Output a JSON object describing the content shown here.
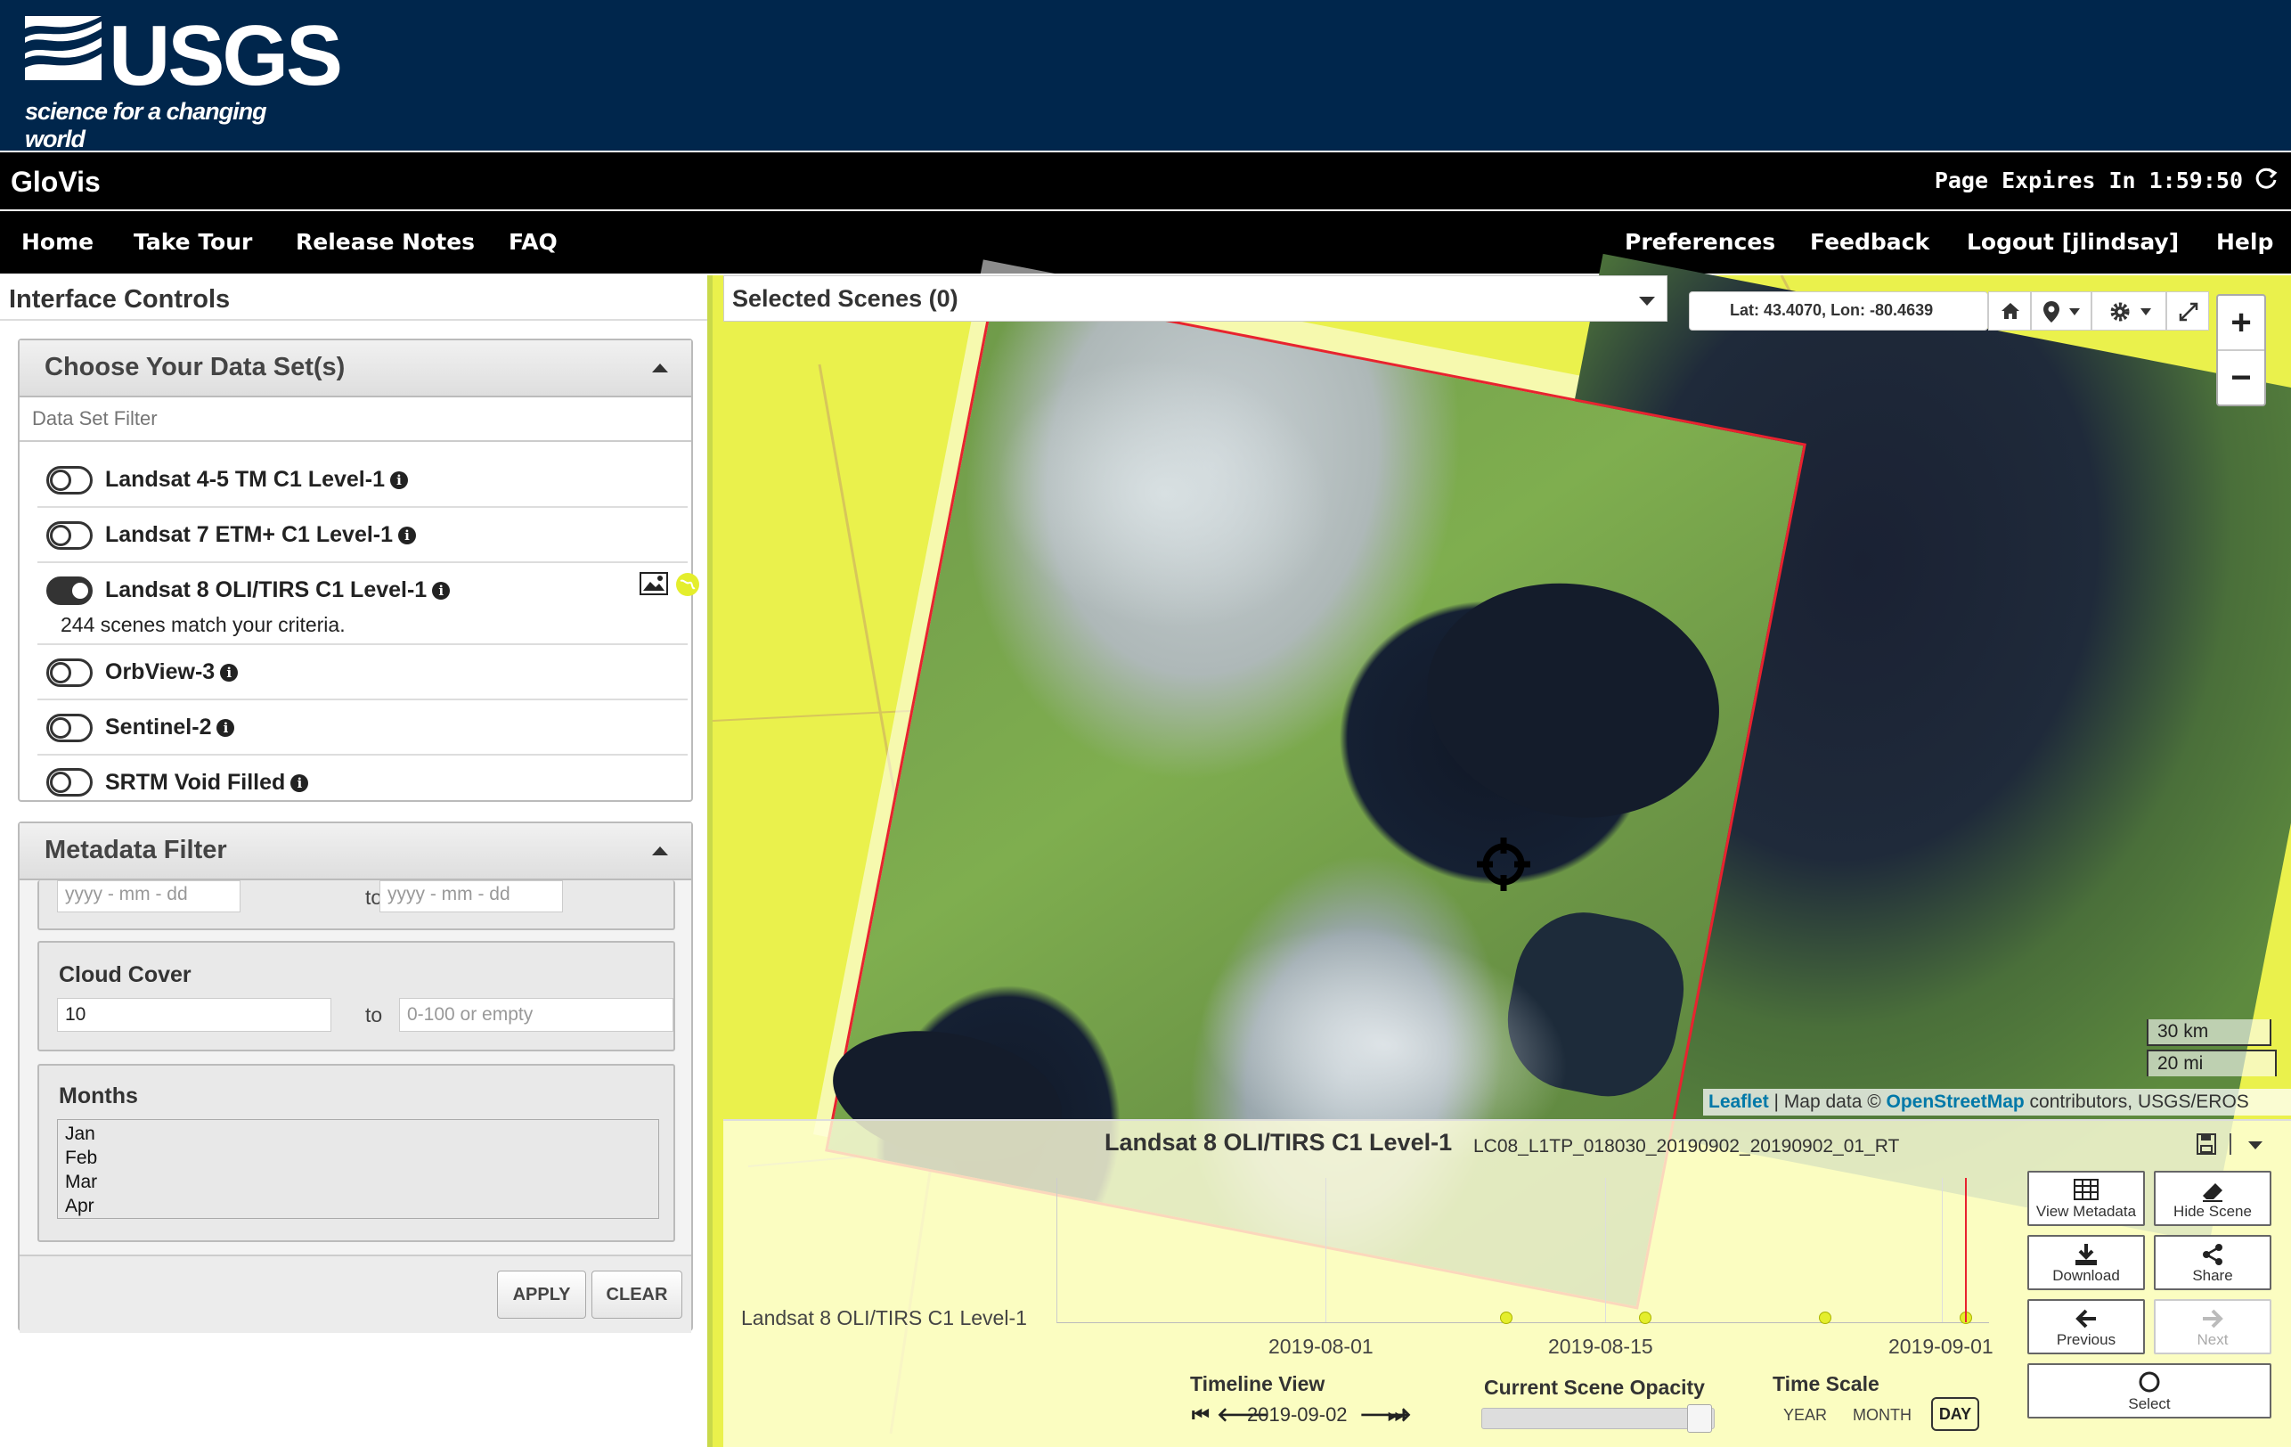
{
  "header": {
    "logo_text": "USGS",
    "logo_tagline": "science for a changing world",
    "app_title": "GloVis",
    "page_expires": "Page Expires In 1:59:50"
  },
  "nav": {
    "left": [
      "Home",
      "Take Tour",
      "Release Notes",
      "FAQ"
    ],
    "right": [
      "Preferences",
      "Feedback",
      "Logout [jlindsay]",
      "Help"
    ]
  },
  "interface_controls": {
    "title": "Interface Controls",
    "datasets_panel": {
      "title": "Choose Your Data Set(s)",
      "filter_placeholder": "Data Set Filter",
      "items": [
        {
          "label": "Landsat 4-5 TM C1 Level-1",
          "enabled": false
        },
        {
          "label": "Landsat 7 ETM+ C1 Level-1",
          "enabled": false
        },
        {
          "label": "Landsat 8 OLI/TIRS C1 Level-1",
          "enabled": true,
          "note": "244 scenes match your criteria."
        },
        {
          "label": "OrbView-3",
          "enabled": false
        },
        {
          "label": "Sentinel-2",
          "enabled": false
        },
        {
          "label": "SRTM Void Filled",
          "enabled": false
        }
      ]
    },
    "metadata_panel": {
      "title": "Metadata Filter",
      "date_from_placeholder": "yyyy - mm - dd",
      "date_to_placeholder": "yyyy - mm - dd",
      "to_label": "to",
      "cloud_cover": {
        "label": "Cloud Cover",
        "from_value": "10",
        "to_placeholder": "0-100 or empty"
      },
      "months": {
        "label": "Months",
        "options": [
          "Jan",
          "Feb",
          "Mar",
          "Apr"
        ]
      },
      "apply_label": "APPLY",
      "clear_label": "CLEAR"
    }
  },
  "map": {
    "selected_scenes": "Selected Scenes (0)",
    "coords": "Lat: 43.4070, Lon: -80.4639",
    "zoom_in": "+",
    "zoom_out": "−",
    "scale_km": "30 km",
    "scale_mi": "20 mi",
    "attribution": {
      "leaflet": "Leaflet",
      "map_data": " | Map data © ",
      "osm": "OpenStreetMap",
      "rest": " contributors, USGS/EROS"
    },
    "colors": {
      "background": "#eaf14c",
      "footprint_border": "#e8232f"
    }
  },
  "timeline": {
    "dataset_title": "Landsat 8 OLI/TIRS C1 Level-1",
    "scene_id": "LC08_L1TP_018030_20190902_20190902_01_RT",
    "y_label": "Landsat 8 OLI/TIRS C1 Level-1",
    "ticks": [
      "2019-08-01",
      "2019-08-15",
      "2019-09-01"
    ],
    "timeline_view_label": "Timeline View",
    "current_date": "2019-09-02",
    "opacity_label": "Current Scene Opacity",
    "opacity_value": 0.9,
    "time_scale_label": "Time Scale",
    "time_scale_options": [
      "YEAR",
      "MONTH",
      "DAY"
    ],
    "time_scale_selected": "DAY",
    "actions": {
      "view_metadata": "View Metadata",
      "hide_scene": "Hide Scene",
      "download": "Download",
      "share": "Share",
      "previous": "Previous",
      "next": "Next",
      "select": "Select"
    }
  }
}
